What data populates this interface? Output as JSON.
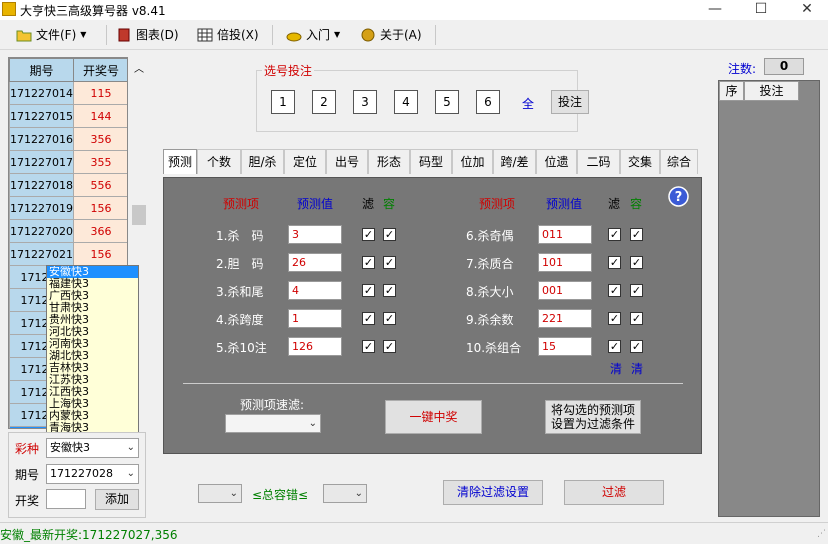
{
  "window": {
    "title": "大亨快三高级算号器 v8.41",
    "min": "—",
    "max": "☐",
    "close": "✕"
  },
  "toolbar": {
    "file": "文件(F)",
    "chart": "图表(D)",
    "multiply": "倍投(X)",
    "intro": "入门",
    "about": "关于(A)"
  },
  "left_table": {
    "headers": [
      "期号",
      "开奖号"
    ],
    "rows": [
      [
        "171227014",
        "115"
      ],
      [
        "171227015",
        "144"
      ],
      [
        "171227016",
        "356"
      ],
      [
        "171227017",
        "355"
      ],
      [
        "171227018",
        "556"
      ],
      [
        "171227019",
        "156"
      ],
      [
        "171227020",
        "366"
      ],
      [
        "171227021",
        "156"
      ],
      [
        "171227",
        ""
      ],
      [
        "171227",
        ""
      ],
      [
        "171227",
        ""
      ],
      [
        "171227",
        ""
      ],
      [
        "171227",
        ""
      ],
      [
        "171227",
        ""
      ],
      [
        "171227",
        ""
      ],
      [
        "1712270",
        ""
      ]
    ]
  },
  "dropdown": {
    "items": [
      "安徽快3",
      "福建快3",
      "广西快3",
      "甘肃快3",
      "贵州快3",
      "河北快3",
      "河南快3",
      "湖北快3",
      "吉林快3",
      "江苏快3",
      "江西快3",
      "上海快3",
      "内蒙快3",
      "青海快3"
    ],
    "selected_index": 0
  },
  "left_bottom": {
    "lottery_label": "彩种",
    "lottery_value": "安徽快3",
    "period_label": "期号",
    "period_value": "171227028",
    "draw_label": "开奖",
    "draw_value": "",
    "add_button": "添加"
  },
  "selection": {
    "title": "选号投注",
    "numbers": [
      "1",
      "2",
      "3",
      "4",
      "5",
      "6"
    ],
    "all": "全",
    "bet": "投注"
  },
  "tabs": [
    "预测",
    "个数",
    "胆/杀",
    "定位",
    "出号",
    "形态",
    "码型",
    "位加",
    "跨/差",
    "位遗",
    "二码",
    "交集",
    "综合"
  ],
  "active_tab": 0,
  "predict": {
    "col_item": "预测项",
    "col_value": "预测值",
    "col_filter": "滤",
    "col_tolerance": "容",
    "left_rows": [
      {
        "label": "1.杀　码",
        "value": "3"
      },
      {
        "label": "2.胆　码",
        "value": "26"
      },
      {
        "label": "3.杀和尾",
        "value": "4"
      },
      {
        "label": "4.杀跨度",
        "value": "1"
      },
      {
        "label": "5.杀10注",
        "value": "126"
      }
    ],
    "right_rows": [
      {
        "label": "6.杀奇偶",
        "value": "011"
      },
      {
        "label": "7.杀质合",
        "value": "101"
      },
      {
        "label": "8.杀大小",
        "value": "001"
      },
      {
        "label": "9.杀余数",
        "value": "221"
      },
      {
        "label": "10.杀组合",
        "value": "15"
      }
    ],
    "clear1": "清",
    "clear2": "清",
    "quick_filter_label": "预测项速滤:",
    "one_click_button": "一键中奖",
    "set_filter_button_line1": "将勾选的预测项",
    "set_filter_button_line2": "设置为过滤条件"
  },
  "bottom": {
    "total_tolerance": "≤总容错≤",
    "clear_filter_button": "清除过滤设置",
    "filter_button": "过滤"
  },
  "right_panel": {
    "count_label": "注数:",
    "count_value": "0",
    "col_seq": "序",
    "col_bet": "投注"
  },
  "status": {
    "text": "安徽_最新开奖:171227027,356"
  },
  "colors": {
    "accent_red": "#d00000",
    "accent_blue": "#0000d0",
    "accent_green": "#008000"
  }
}
